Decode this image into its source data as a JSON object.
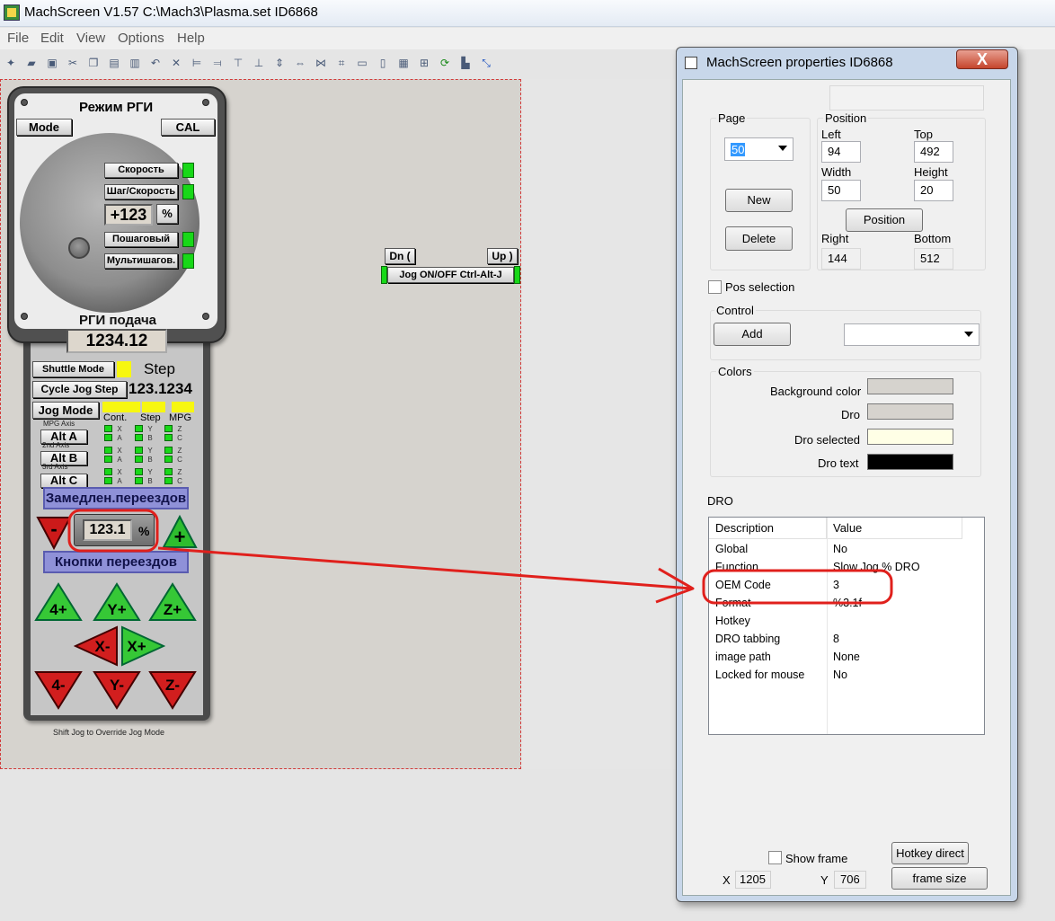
{
  "app": {
    "title": "MachScreen V1.57   C:\\Mach3\\Plasma.set   ID6868",
    "menu": [
      "File",
      "Edit",
      "View",
      "Options",
      "Help"
    ],
    "toolbar_icons": [
      "new-icon",
      "open-icon",
      "save-icon",
      "cut-icon",
      "copy-icon",
      "paste-icon",
      "print-icon",
      "undo-icon",
      "delete-icon",
      "align-left-icon",
      "align-right-icon",
      "align-top-icon",
      "align-bottom-icon",
      "center-vertical-icon",
      "center-horizontal-icon",
      "space-horizontal-icon",
      "space-vertical-icon",
      "same-size-icon",
      "same-width-icon",
      "grid-icon",
      "grid-snap-icon",
      "refresh-icon",
      "test-icon",
      "wizard-icon"
    ]
  },
  "pendant": {
    "title": "Режим РГИ",
    "mode_btn": "Mode",
    "cal_btn": "CAL",
    "speed_btn": "Скорость",
    "step_speed_btn": "Шаг/Скорость",
    "percent_dro": "+123",
    "percent_btn": "%",
    "step_btn": "Пошаговый",
    "multistep_btn": "Мультишагов.",
    "feed_title": "РГИ подача",
    "feed_dro": "1234.12",
    "shuttle_btn": "Shuttle Mode",
    "step_label": "Step",
    "cycle_btn": "Cycle Jog Step",
    "step_dro": "123.1234",
    "jogmode_btn": "Jog Mode",
    "col_cont": "Cont.",
    "col_step": "Step",
    "col_mpg": "MPG",
    "mpg_axis_label": "MPG Axis",
    "axis2_label": "2nd Axis",
    "axis3_label": "3rd Axis",
    "alt_a": "Alt A",
    "alt_b": "Alt B",
    "alt_c": "Alt C",
    "ax_x": "X",
    "ax_a": "A",
    "ax_y": "Y",
    "ax_b": "B",
    "ax_z": "Z",
    "ax_c": "C",
    "slow_banner": "Замедлен.переездов",
    "slow_minus": "-",
    "slow_dro": "123.1",
    "slow_pct": "%",
    "slow_plus": "+",
    "buttons_banner": "Кнопки переездов",
    "jog": {
      "p4": "4+",
      "py": "Y+",
      "pz": "Z+",
      "mx": "X-",
      "px": "X+",
      "m4": "4-",
      "my": "Y-",
      "mz": "Z-"
    },
    "footer": "Shift Jog to Override Jog Mode"
  },
  "small_jog": {
    "dn": "Dn (",
    "up": "Up )",
    "toggle": "Jog ON/OFF Ctrl-Alt-J"
  },
  "dialog": {
    "title": "MachScreen properties  ID6868",
    "close": "X",
    "page": {
      "label": "Page",
      "value": "50",
      "new_btn": "New",
      "delete_btn": "Delete"
    },
    "position": {
      "label": "Position",
      "left_label": "Left",
      "left_value": "94",
      "top_label": "Top",
      "top_value": "492",
      "width_label": "Width",
      "width_value": "50",
      "height_label": "Height",
      "height_value": "20",
      "position_btn": "Position",
      "right_label": "Right",
      "right_value": "144",
      "bottom_label": "Bottom",
      "bottom_value": "512"
    },
    "pos_selection": "Pos selection",
    "control": {
      "label": "Control",
      "add_btn": "Add",
      "select_value": ""
    },
    "colors": {
      "label": "Colors",
      "background": {
        "label": "Background color",
        "hex": "#d6d3ce"
      },
      "dro": {
        "label": "Dro",
        "hex": "#d6d3ce"
      },
      "dro_selected": {
        "label": "Dro selected",
        "hex": "#ffffe6"
      },
      "dro_text": {
        "label": "Dro text",
        "hex": "#000000"
      }
    },
    "dro_label": "DRO",
    "grid": {
      "headers": [
        "Description",
        "Value"
      ],
      "rows": [
        {
          "desc": "Global",
          "value": "No"
        },
        {
          "desc": "Function",
          "value": "Slow Jog % DRO"
        },
        {
          "desc": "OEM Code",
          "value": "3"
        },
        {
          "desc": "Format",
          "value": "%3.1f"
        },
        {
          "desc": "Hotkey",
          "value": ""
        },
        {
          "desc": "DRO tabbing",
          "value": "8"
        },
        {
          "desc": "image path",
          "value": "None"
        },
        {
          "desc": "Locked for mouse",
          "value": "No"
        }
      ]
    },
    "show_frame": "Show frame",
    "hotkey_direct": "Hotkey direct",
    "frame_size": "frame size",
    "x_label": "X",
    "x_value": "1205",
    "y_label": "Y",
    "y_value": "706"
  },
  "annotation_color": "#e0201c"
}
